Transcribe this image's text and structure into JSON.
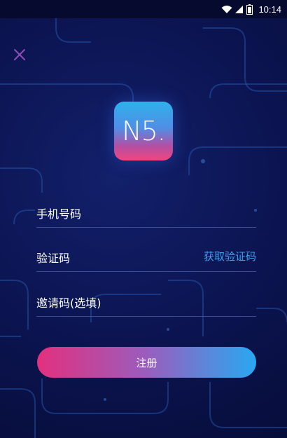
{
  "status_bar": {
    "time": "10:14",
    "icons": [
      "wifi-icon",
      "signal-icon",
      "battery-icon"
    ]
  },
  "close_icon": "close-icon",
  "logo": {
    "text": "N5.",
    "gradient_colors": [
      "#2fb1ea",
      "#f0467e"
    ]
  },
  "form": {
    "phone_label": "手机号码",
    "code_label": "验证码",
    "get_code_label": "获取验证码",
    "invite_label": "邀请码(选填)"
  },
  "register_button": {
    "label": "注册",
    "gradient_colors": [
      "#e3307e",
      "#29a8f1"
    ]
  },
  "colors": {
    "background": "#0b1450",
    "accent_link": "#36a3f0",
    "divider": "#3a4d98"
  }
}
